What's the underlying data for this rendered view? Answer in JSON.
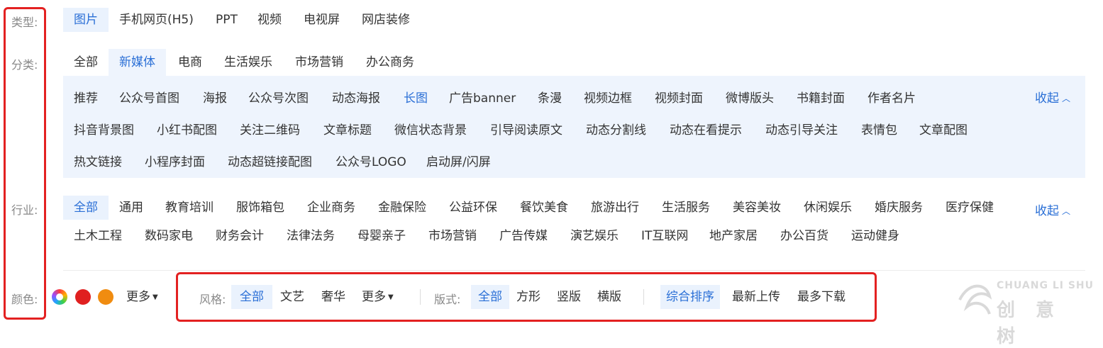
{
  "type_row": {
    "label": "类型:",
    "items": [
      "图片",
      "手机网页(H5)",
      "PPT",
      "视频",
      "电视屏",
      "网店装修"
    ]
  },
  "category_row": {
    "label": "分类:",
    "items": [
      "全部",
      "新媒体",
      "电商",
      "生活娱乐",
      "市场营销",
      "办公商务"
    ],
    "sub_items_row1": [
      "推荐",
      "公众号首图",
      "海报",
      "公众号次图",
      "动态海报",
      "长图",
      "广告banner",
      "条漫",
      "视频边框",
      "视频封面",
      "微博版头",
      "书籍封面",
      "作者名片"
    ],
    "sub_items_row2": [
      "抖音背景图",
      "小红书配图",
      "关注二维码",
      "文章标题",
      "微信状态背景",
      "引导阅读原文",
      "动态分割线",
      "动态在看提示",
      "动态引导关注",
      "表情包",
      "文章配图"
    ],
    "sub_items_row3": [
      "热文链接",
      "小程序封面",
      "动态超链接配图",
      "公众号LOGO",
      "启动屏/闪屏"
    ],
    "collapse_label": "收起"
  },
  "industry_row": {
    "label": "行业:",
    "items_row1": [
      "全部",
      "通用",
      "教育培训",
      "服饰箱包",
      "企业商务",
      "金融保险",
      "公益环保",
      "餐饮美食",
      "旅游出行",
      "生活服务",
      "美容美妆",
      "休闲娱乐",
      "婚庆服务",
      "医疗保健"
    ],
    "items_row2": [
      "土木工程",
      "数码家电",
      "财务会计",
      "法律法务",
      "母婴亲子",
      "市场营销",
      "广告传媒",
      "演艺娱乐",
      "IT互联网",
      "地产家居",
      "办公百货",
      "运动健身"
    ],
    "collapse_label": "收起"
  },
  "filter_row": {
    "color_label": "颜色:",
    "color_swatches": [
      "rainbow",
      "#e02020",
      "#f08c10"
    ],
    "color_more": "更多",
    "style_label": "风格:",
    "style_items": [
      "全部",
      "文艺",
      "奢华"
    ],
    "style_more": "更多",
    "layout_label": "版式:",
    "layout_items": [
      "全部",
      "方形",
      "竖版",
      "横版"
    ],
    "sort_items": [
      "综合排序",
      "最新上传",
      "最多下载"
    ]
  },
  "watermark": {
    "text_en": "CHUANG LI SHU",
    "text_cn": "创 意 树"
  },
  "colors": {
    "accent": "#2a6fd6",
    "selected_bg": "#eaf2fd",
    "panel_bg": "#eef4fd",
    "highlight_border": "#e32121"
  }
}
